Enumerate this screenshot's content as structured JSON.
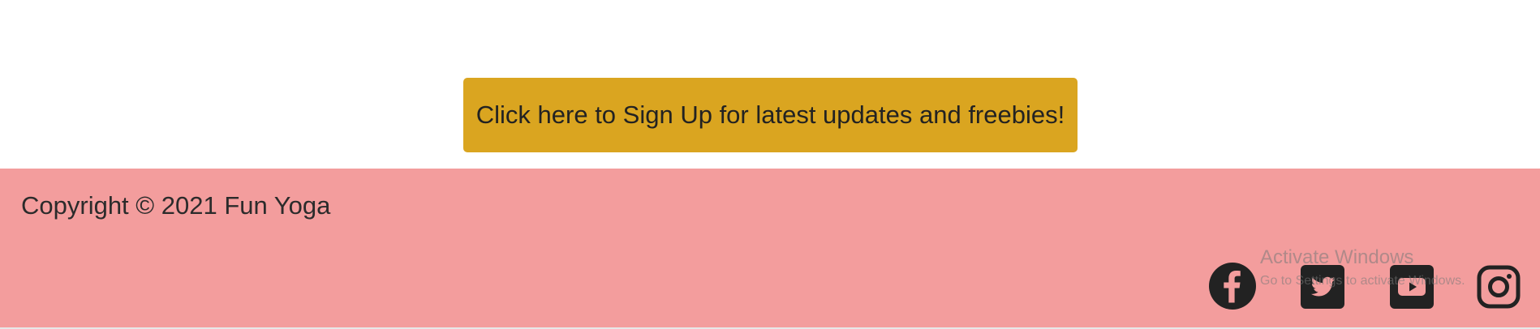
{
  "signup": {
    "button_label": "Click here to Sign Up for latest updates and freebies!",
    "button_color": "#daa520"
  },
  "footer": {
    "background_color": "#f39d9d",
    "copyright": "Copyright © 2021 Fun Yoga",
    "social_icons": [
      "facebook-icon",
      "twitter-icon",
      "youtube-icon",
      "instagram-icon"
    ]
  },
  "watermark": {
    "title": "Activate Windows",
    "subtitle": "Go to Settings to activate Windows."
  }
}
